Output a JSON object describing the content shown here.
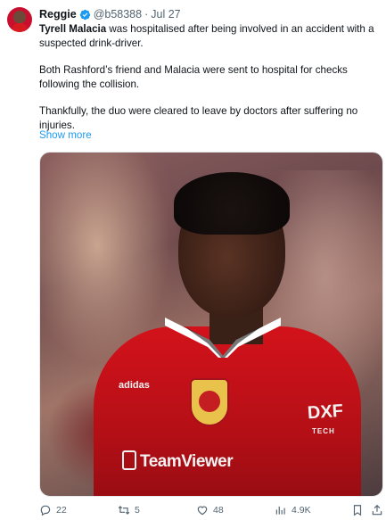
{
  "author": {
    "name": "Reggie",
    "handle": "@b58388",
    "separator": "·",
    "date": "Jul 27",
    "avatar_icon": "profile-avatar",
    "verified_color": "#1d9bf0"
  },
  "tweet": {
    "subject": "Tyrell Malacia",
    "line1_rest": " was hospitalised after being involved in an accident with a suspected drink-driver.",
    "paragraph2": "Both Rashford’s friend and Malacia were sent to hospital for checks following the collision.",
    "paragraph3": "Thankfully, the duo were cleared to leave by doctors after suffering no injuries.",
    "show_more": "Show more"
  },
  "media": {
    "description_icon": "football-player-photo",
    "kit_brand": "adidas",
    "sponsor": "TeamViewer",
    "badge_text": "DXF",
    "badge_sub": "TECH"
  },
  "actions": {
    "replies": "22",
    "retweets": "5",
    "likes": "48",
    "views": "4.9K",
    "accent": "#536471"
  }
}
